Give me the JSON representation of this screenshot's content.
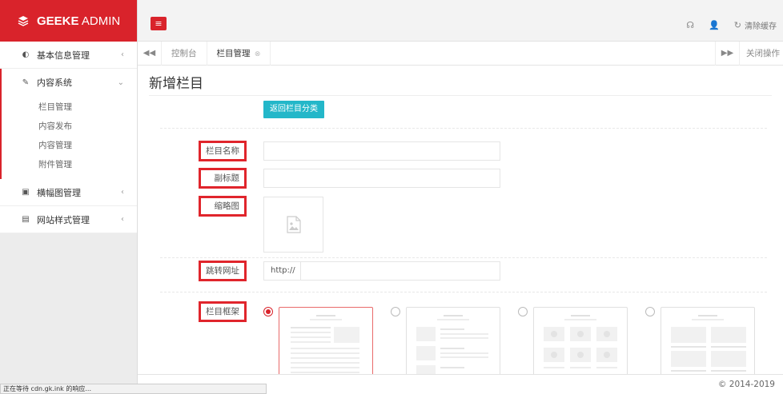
{
  "app": {
    "brand_bold": "GEEKE",
    "brand_rest": "ADMIN",
    "accent": "#d9232b",
    "teal": "#23b7c9"
  },
  "sidebar": {
    "items": [
      {
        "label": "基本信息管理",
        "icon": "globe-icon"
      },
      {
        "label": "内容系统",
        "icon": "edit-icon",
        "expanded": true,
        "children": [
          "栏目管理",
          "内容发布",
          "内容管理",
          "附件管理"
        ]
      },
      {
        "label": "横幅图管理",
        "icon": "image-icon"
      },
      {
        "label": "网站样式管理",
        "icon": "layout-icon"
      }
    ]
  },
  "topbar": {
    "clear_cache": "清除缓存"
  },
  "tabs": {
    "items": [
      "控制台",
      "栏目管理"
    ],
    "close_ops": "关闭操作"
  },
  "content": {
    "title": "新增栏目",
    "back_button": "返回栏目分类",
    "fields": {
      "name_label": "栏目名称",
      "subtitle_label": "副标题",
      "thumb_label": "缩略图",
      "url_label": "跳转网址",
      "url_prefix": "http://",
      "frame_label": "栏目框架"
    },
    "frames_selected_index": 0
  },
  "footer": {
    "copyright": "© 2014-2019"
  },
  "statusbar": {
    "text": "正在等待 cdn.gk.ink 的响应..."
  }
}
